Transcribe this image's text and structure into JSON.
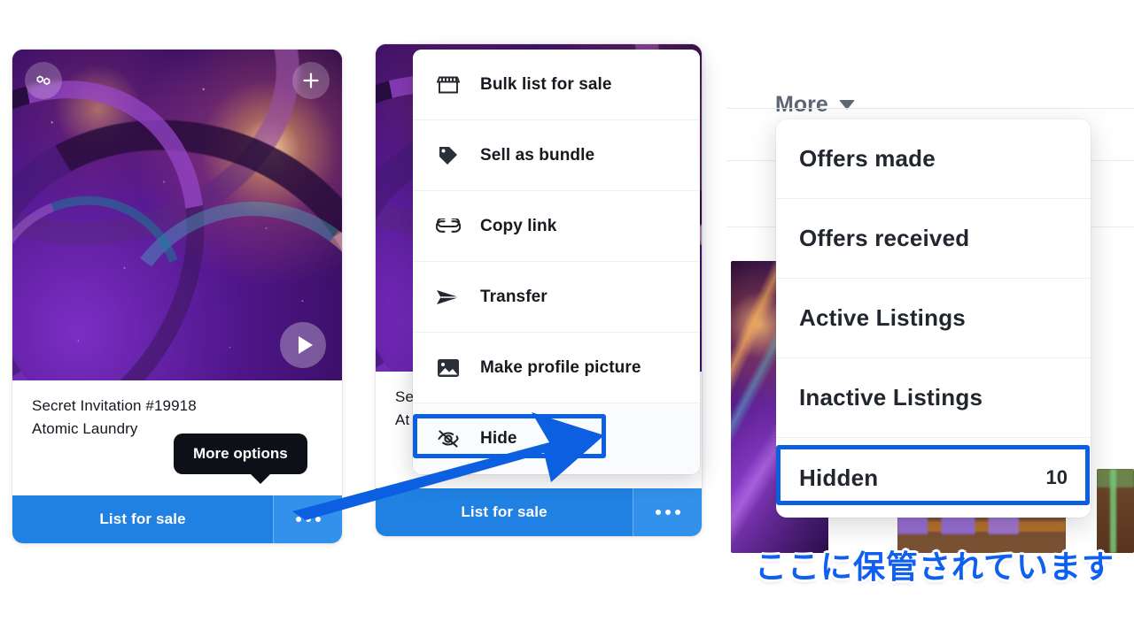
{
  "left_card": {
    "chain_icon": "polygon-icon",
    "add_icon": "plus-icon",
    "play_icon": "play-icon",
    "title": "Secret Invitation #19918",
    "subtitle": "Atomic Laundry",
    "list_button_label": "List for sale",
    "more_icon": "ellipsis-icon",
    "tooltip": "More options"
  },
  "middle_card": {
    "title_clipped": "Se",
    "subtitle_clipped": "At",
    "list_button_label": "List for sale",
    "more_icon": "ellipsis-icon"
  },
  "context_menu": {
    "items": [
      {
        "label": "Bulk list for sale",
        "icon": "storefront-icon"
      },
      {
        "label": "Sell as bundle",
        "icon": "tag-icon"
      },
      {
        "label": "Copy link",
        "icon": "link-icon"
      },
      {
        "label": "Transfer",
        "icon": "send-icon"
      },
      {
        "label": "Make profile picture",
        "icon": "image-icon"
      },
      {
        "label": "Hide",
        "icon": "eye-off-icon"
      }
    ]
  },
  "right_panel": {
    "more_trigger_label": "More",
    "chevron_icon": "chevron-down-icon",
    "dropdown_items": [
      {
        "label": "Offers made",
        "count": ""
      },
      {
        "label": "Offers received",
        "count": ""
      },
      {
        "label": "Active Listings",
        "count": ""
      },
      {
        "label": "Inactive Listings",
        "count": ""
      },
      {
        "label": "Hidden",
        "count": "10"
      }
    ]
  },
  "annotations": {
    "caption_jp": "ここに保管されています",
    "highlight_color": "#0b5fe0",
    "arrow_color": "#0b5fe0",
    "accent_blue": "#2081e2",
    "accent_blue_light": "#3291ea"
  }
}
